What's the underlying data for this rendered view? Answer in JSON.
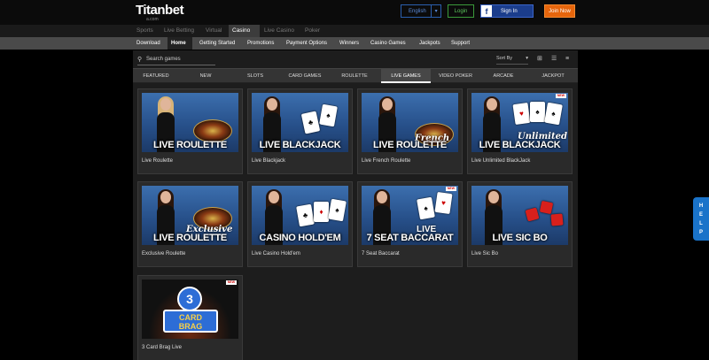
{
  "header": {
    "logo": "Titanbet",
    "logo_sub": "a.com",
    "language": "English",
    "login": "Login",
    "facebook_signin": "Sign In",
    "facebook_letter": "f",
    "join": "Join Now"
  },
  "topnav": [
    "Sports",
    "Live Betting",
    "Virtual",
    "Casino",
    "Live Casino",
    "Poker"
  ],
  "topnav_active": "Casino",
  "subnav": [
    "Download",
    "Home",
    "Getting Started",
    "Promotions",
    "Payment Options",
    "Winners",
    "Casino Games",
    "Jackpots",
    "Support"
  ],
  "subnav_active": "Home",
  "toolbar": {
    "search_placeholder": "Search games",
    "sort_label": "Sort By"
  },
  "categories": [
    "Featured",
    "New",
    "Slots",
    "Card Games",
    "Roulette",
    "Live Games",
    "Video Poker",
    "Arcade",
    "Jackpot"
  ],
  "category_active": "Live Games",
  "games": [
    {
      "name": "Live Roulette",
      "thumb_title": "LIVE ROULETTE",
      "script": "",
      "new": false
    },
    {
      "name": "Live Blackjack",
      "thumb_title": "LIVE BLACKJACK",
      "script": "",
      "new": false
    },
    {
      "name": "Live French Roulette",
      "thumb_title": "LIVE ROULETTE",
      "script": "French",
      "new": false
    },
    {
      "name": "Live Unlimited BlackJack",
      "thumb_title": "LIVE BLACKJACK",
      "script": "Unlimited",
      "new": true
    },
    {
      "name": "Exclusive Roulette",
      "thumb_title": "LIVE ROULETTE",
      "script": "Exclusive",
      "new": false
    },
    {
      "name": "Live Casino Hold'em",
      "thumb_title": "CASINO HOLD'EM",
      "script": "",
      "new": false
    },
    {
      "name": "7 Seat Baccarat",
      "thumb_title": "7 SEAT BACCARAT",
      "script": "LIVE",
      "new": true
    },
    {
      "name": "Live Sic Bo",
      "thumb_title": "LIVE SIC BO",
      "script": "",
      "new": false
    },
    {
      "name": "3 Card Brag Live",
      "thumb_title": "",
      "script": "",
      "new": true
    }
  ],
  "brag": {
    "number": "3",
    "line1": "CARD",
    "line2": "BRAG"
  },
  "new_tag": "NEW",
  "help": [
    "H",
    "E",
    "L",
    "P"
  ],
  "colors": {
    "accent": "#e6650c",
    "facebook": "#1b3d8c",
    "help": "#1a73c9",
    "login": "#3a9a3a"
  }
}
